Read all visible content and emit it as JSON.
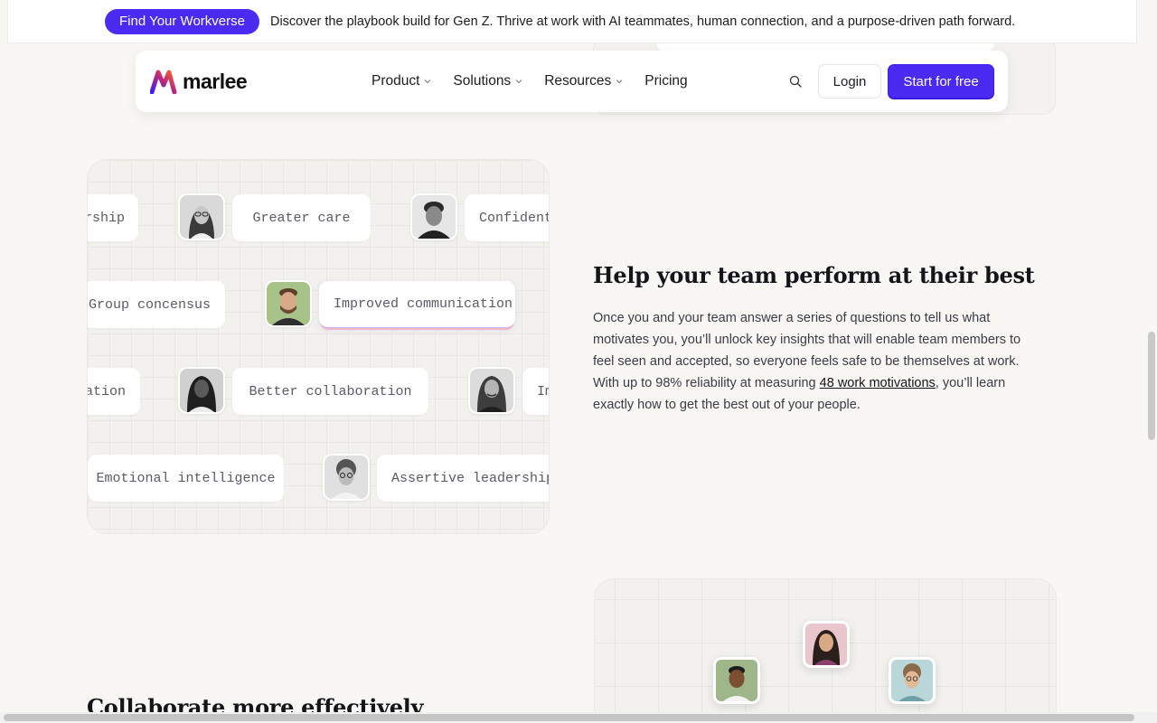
{
  "announcement": {
    "button_label": "Find Your Workverse",
    "text": "Discover the playbook build for Gen Z. Thrive at work with AI teammates, human connection, and a purpose-driven path forward."
  },
  "nav": {
    "logo_text": "marlee",
    "links": [
      {
        "label": "Product",
        "dropdown": true
      },
      {
        "label": "Solutions",
        "dropdown": true
      },
      {
        "label": "Resources",
        "dropdown": true
      },
      {
        "label": "Pricing",
        "dropdown": false
      }
    ],
    "login_label": "Login",
    "start_label": "Start for free"
  },
  "traits": {
    "row1": [
      "rship",
      "Greater care",
      "Confident"
    ],
    "row2": [
      "Group concensus",
      "Improved communication"
    ],
    "row3": [
      "ation",
      "Better collaboration",
      "Im"
    ],
    "row4": [
      "Emotional intelligence",
      "Assertive leadership"
    ]
  },
  "section1": {
    "heading": "Help your team perform at their best",
    "para_before": "Once you and your team answer a series of questions to tell us what motivates you, you’ll unlock key insights that will enable team members to feel seen and accepted, so everyone feels safe to be themselves at work. With up to 98% reliability at measuring ",
    "link": "48 work motivations",
    "para_after": ", you’ll learn exactly how to get the best out of your people."
  },
  "section2": {
    "heading": "Collaborate more effectively"
  },
  "colors": {
    "accent": "#4b2bf1",
    "background": "#f8f7f4"
  }
}
